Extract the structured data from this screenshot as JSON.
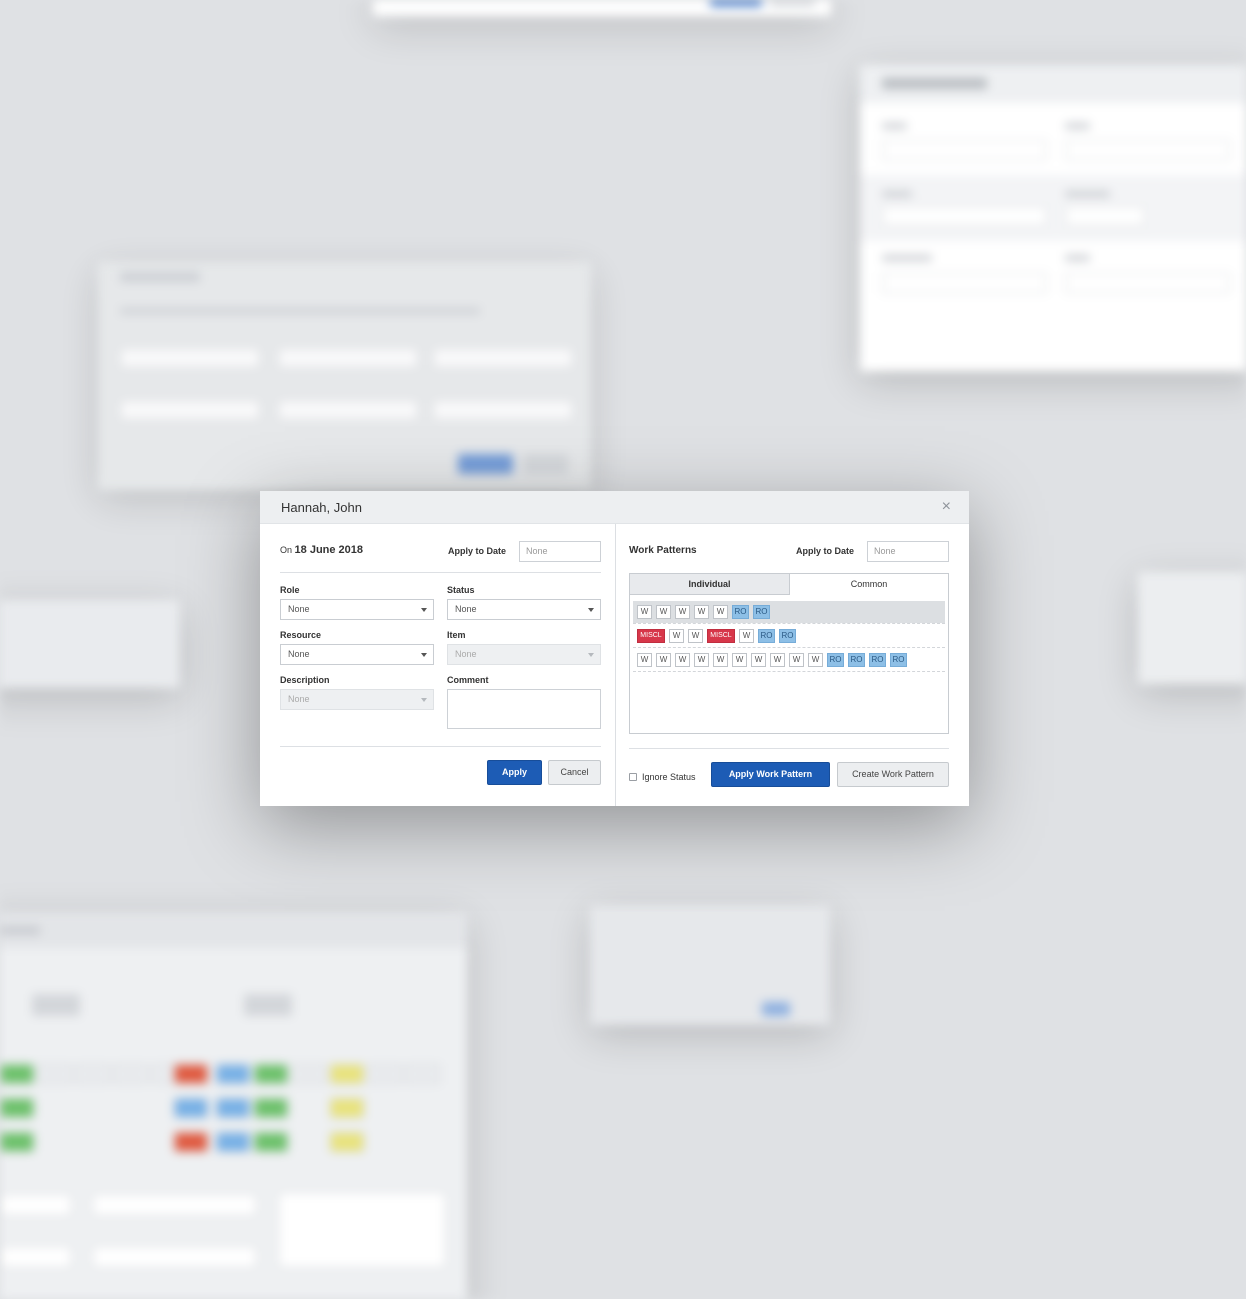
{
  "modal": {
    "title": "Hannah, John",
    "close_glyph": "×",
    "left": {
      "on_prefix": "On",
      "date": "18 June 2018",
      "apply_to_date_label": "Apply to Date",
      "apply_to_date_placeholder": "None",
      "role": {
        "label": "Role",
        "value": "None"
      },
      "status": {
        "label": "Status",
        "value": "None"
      },
      "resource": {
        "label": "Resource",
        "value": "None"
      },
      "item": {
        "label": "Item",
        "value": "None"
      },
      "description": {
        "label": "Description",
        "value": "None"
      },
      "comment": {
        "label": "Comment",
        "value": ""
      },
      "apply_button": "Apply",
      "cancel_button": "Cancel"
    },
    "right": {
      "title": "Work Patterns",
      "apply_to_date_label": "Apply to Date",
      "apply_to_date_placeholder": "None",
      "tabs": [
        {
          "label": "Individual",
          "active": true
        },
        {
          "label": "Common",
          "active": false
        }
      ],
      "patterns": [
        {
          "selected": true,
          "days": [
            "W",
            "W",
            "W",
            "W",
            "W",
            "RO",
            "RO"
          ]
        },
        {
          "selected": false,
          "days": [
            "MISCL",
            "W",
            "W",
            "MISCL",
            "W",
            "RO",
            "RO"
          ]
        },
        {
          "selected": false,
          "days": [
            "W",
            "W",
            "W",
            "W",
            "W",
            "W",
            "W",
            "W",
            "W",
            "W",
            "RO",
            "RO",
            "RO",
            "RO"
          ]
        }
      ],
      "ignore_status_label": "Ignore Status",
      "ignore_status_checked": false,
      "apply_work_pattern_button": "Apply Work Pattern",
      "create_work_pattern_button": "Create Work Pattern"
    }
  },
  "colors": {
    "primary": "#1d5cb5",
    "rest_off": "#8dbfe6",
    "misc": "#d7374a"
  },
  "icons": {
    "close": "close-icon",
    "dropdown": "chevron-down-icon"
  }
}
